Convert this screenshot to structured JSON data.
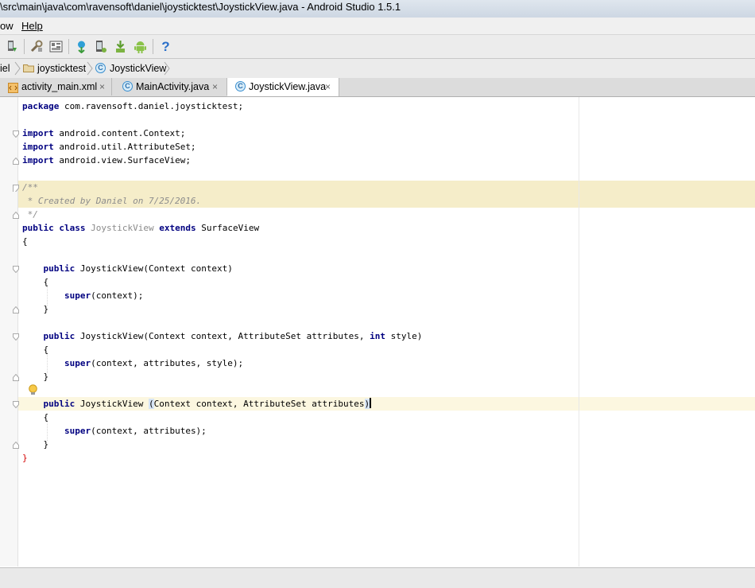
{
  "window": {
    "title": "\\src\\main\\java\\com\\ravensoft\\daniel\\joysticktest\\JoystickView.java - Android Studio 1.5.1"
  },
  "menu": [
    "ow",
    "Help"
  ],
  "toolbar": {
    "icons": [
      "sdk-manager-icon",
      "project-structure-icon",
      "layout-icon",
      "sync-gradle-icon",
      "avd-manager-icon",
      "download-icon",
      "android-icon",
      "help-icon"
    ],
    "help_glyph": "?"
  },
  "breadcrumb": {
    "items": [
      "iel",
      "joysticktest",
      "JoystickView"
    ],
    "class_glyph": "C"
  },
  "tabs": [
    {
      "label": "activity_main.xml",
      "close": "×",
      "active": false
    },
    {
      "label": "MainActivity.java",
      "close": "×",
      "active": false
    },
    {
      "label": "JoystickView.java",
      "close": "×",
      "active": true
    }
  ],
  "code": {
    "package_kw": "package",
    "package_name": " com.ravensoft.daniel.joysticktest;",
    "import_kw": "import",
    "imports": [
      " android.content.Context;",
      " android.util.AttributeSet;",
      " android.view.SurfaceView;"
    ],
    "doc_open": "/**",
    "doc_body": " * Created by Daniel on 7/25/2016.",
    "doc_close": " */",
    "public_kw": "public",
    "class_kw": "class",
    "class_name": "JoystickView",
    "extends_kw": "extends",
    "superclass": " SurfaceView",
    "open_brace": "{",
    "close_brace": "}",
    "ctor1_sig": " JoystickView(Context context)",
    "super_kw": "super",
    "super1_args": "(context);",
    "ctor2_sig_a": " JoystickView(Context context, AttributeSet attributes, ",
    "int_kw": "int",
    "ctor2_sig_b": " style)",
    "super2_args": "(context, attributes, style);",
    "ctor3_name": " JoystickView ",
    "ctor3_lparen": "(",
    "ctor3_params": "Context context, AttributeSet attributes",
    "ctor3_rparen": ")",
    "super3_args": "(context, attributes);"
  },
  "colors": {
    "keyword": "#000080",
    "comment": "#8c8c8c",
    "doc_highlight": "#f5edc9",
    "caret_line": "#fcf7e0",
    "brace_match": "#d40000"
  }
}
